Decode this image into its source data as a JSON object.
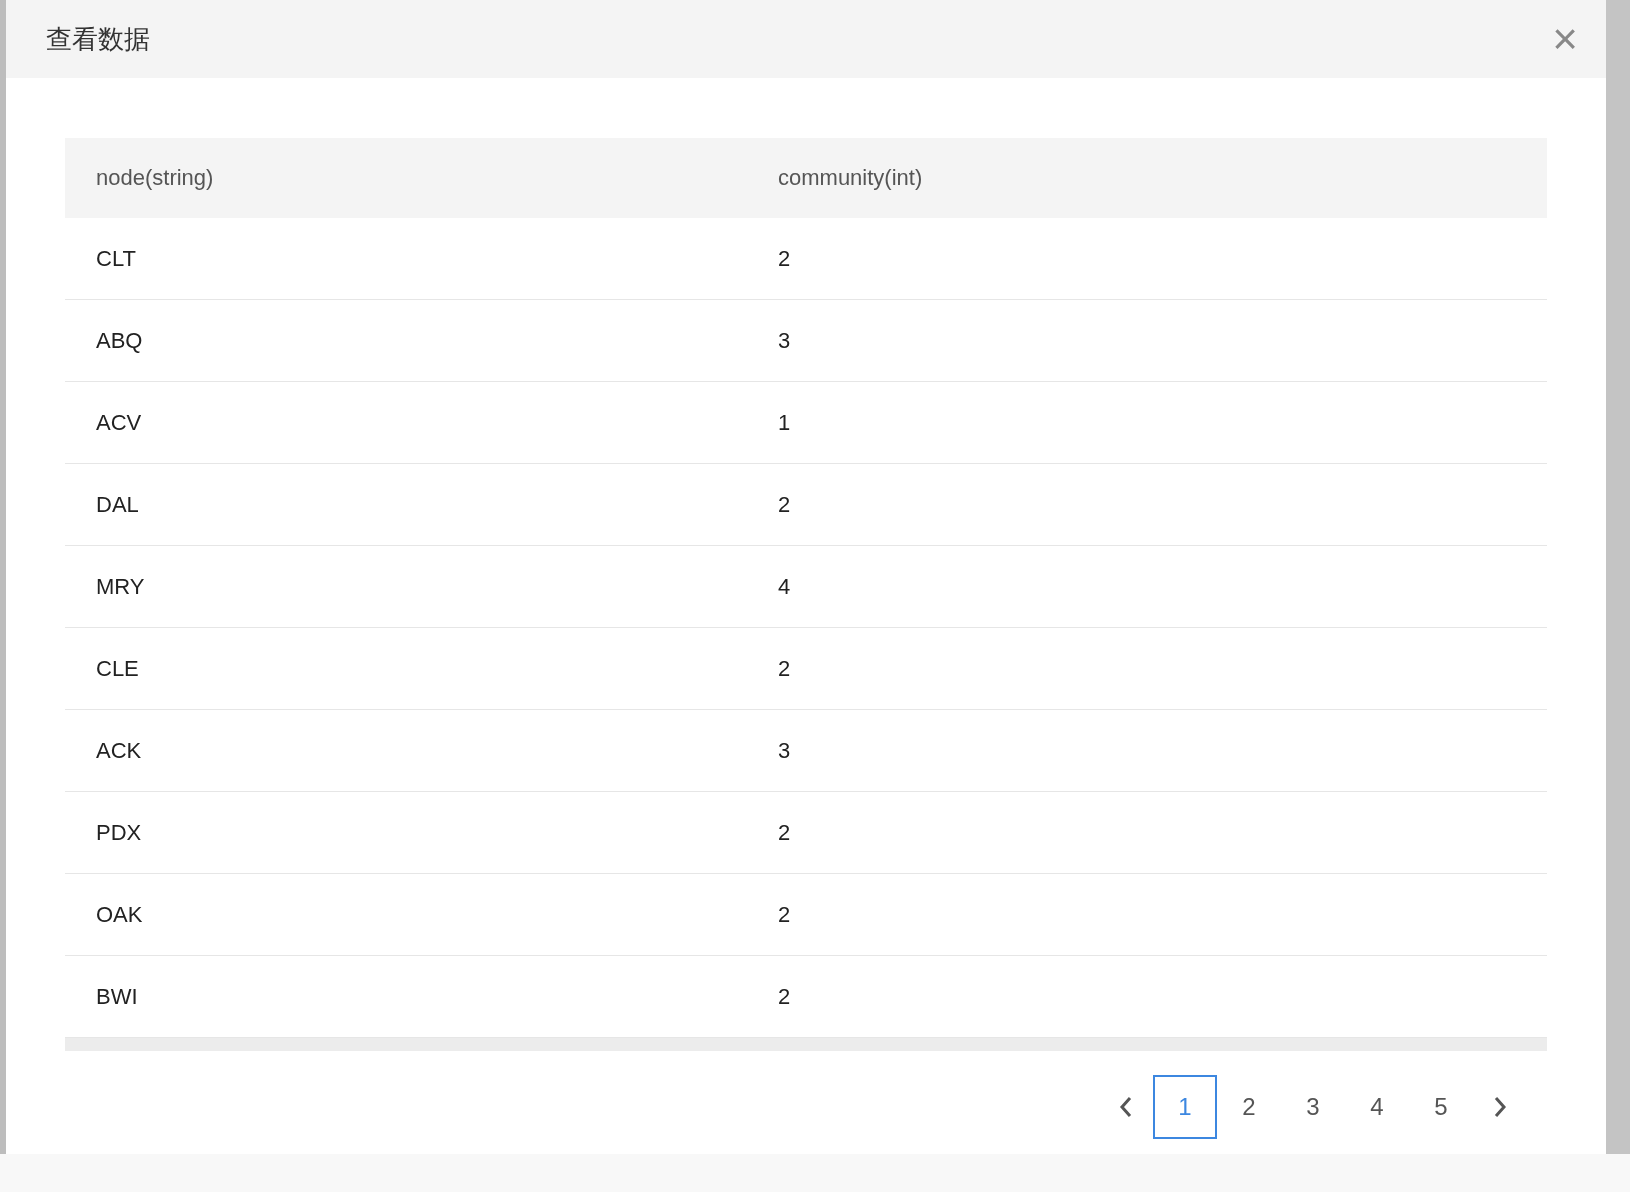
{
  "dialog": {
    "title": "查看数据",
    "close": "×"
  },
  "table": {
    "columns": [
      "node(string)",
      "community(int)"
    ],
    "rows": [
      [
        "CLT",
        "2"
      ],
      [
        "ABQ",
        "3"
      ],
      [
        "ACV",
        "1"
      ],
      [
        "DAL",
        "2"
      ],
      [
        "MRY",
        "4"
      ],
      [
        "CLE",
        "2"
      ],
      [
        "ACK",
        "3"
      ],
      [
        "PDX",
        "2"
      ],
      [
        "OAK",
        "2"
      ],
      [
        "BWI",
        "2"
      ]
    ]
  },
  "pagination": {
    "pages": [
      {
        "label": "1",
        "selected": true
      },
      {
        "label": "2",
        "selected": false
      },
      {
        "label": "3",
        "selected": false
      },
      {
        "label": "4",
        "selected": false
      },
      {
        "label": "5",
        "selected": false
      }
    ]
  }
}
